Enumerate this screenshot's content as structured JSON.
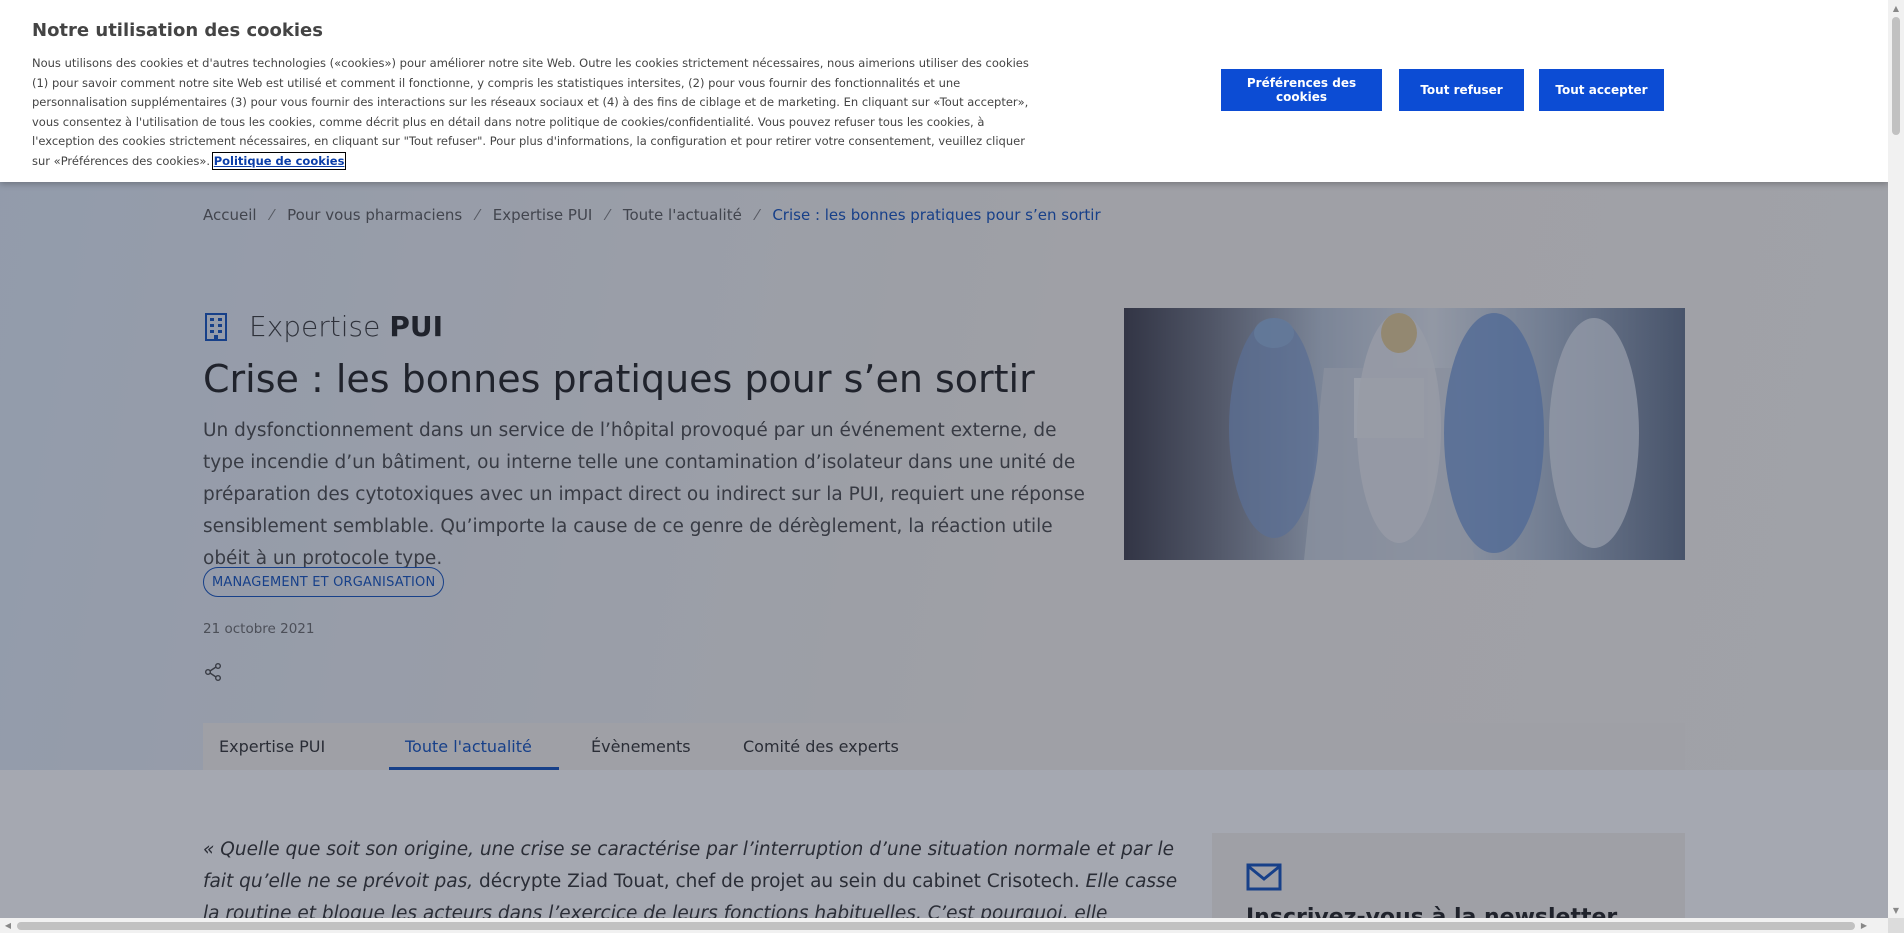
{
  "cookie_banner": {
    "title": "Notre utilisation des cookies",
    "text": "Nous utilisons des cookies et d'autres technologies («cookies») pour améliorer notre site Web. Outre les cookies strictement nécessaires, nous aimerions utiliser des cookies (1) pour savoir comment notre site Web est utilisé et comment il fonctionne, y compris les statistiques intersites, (2) pour vous fournir des fonctionnalités et une personnalisation supplémentaires (3) pour vous fournir des interactions sur les réseaux sociaux et (4) à des fins de ciblage et de marketing. En cliquant sur «Tout accepter», vous consentez à l'utilisation de tous les cookies, comme décrit plus en détail dans notre politique de cookies/confidentialité. Vous pouvez refuser tous les cookies, à l'exception des cookies strictement nécessaires, en cliquant sur \"Tout refuser\". Pour plus d'informations, la configuration et pour retirer votre consentement, veuillez cliquer sur «Préférences des cookies».",
    "policy_link": "Politique de cookies",
    "buttons": {
      "preferences": "Préférences des cookies",
      "reject": "Tout refuser",
      "accept": "Tout accepter"
    }
  },
  "breadcrumb": {
    "items": [
      "Accueil",
      "Pour vous pharmaciens",
      "Expertise PUI",
      "Toute l'actualité",
      "Crise : les bonnes pratiques pour s’en sortir"
    ],
    "separator": "⁄"
  },
  "article": {
    "section_light": "Expertise",
    "section_bold": "PUI",
    "title": "Crise : les bonnes pratiques pour s’en sortir",
    "lede": "Un dysfonctionnement dans un service de l’hôpital provoqué par un événement externe, de type incendie d’un bâtiment, ou interne telle une contamination d’isolateur dans une unité de préparation des cytotoxiques avec un impact direct ou indirect sur la PUI, requiert une réponse sensiblement semblable. Qu’importe la cause de ce genre de dérèglement, la réaction utile obéit à un protocole type.",
    "tag": "MANAGEMENT ET ORGANISATION",
    "date": "21 octobre 2021",
    "body_italic_1": "« Quelle que soit son origine, une crise se caractérise par l’interruption d’une situation normale et par le fait qu’elle ne se prévoit pas,",
    "body_normal": " décrypte Ziad Touat, chef de projet au sein du cabinet Crisotech.",
    "body_italic_2": " Elle casse la routine et bloque les acteurs dans l’exercice de leurs fonctions habituelles. C’est pourquoi, elle génère initialement un phénomène de"
  },
  "tabs": [
    {
      "label": "Expertise PUI",
      "active": false
    },
    {
      "label": "Toute l'actualité",
      "active": true
    },
    {
      "label": "Évènements",
      "active": false
    },
    {
      "label": "Comité des experts",
      "active": false
    }
  ],
  "newsletter": {
    "heading": "Inscrivez-vous à la newsletter"
  },
  "colors": {
    "brand_blue": "#0c4cd4",
    "link_blue": "#0c4cba"
  }
}
